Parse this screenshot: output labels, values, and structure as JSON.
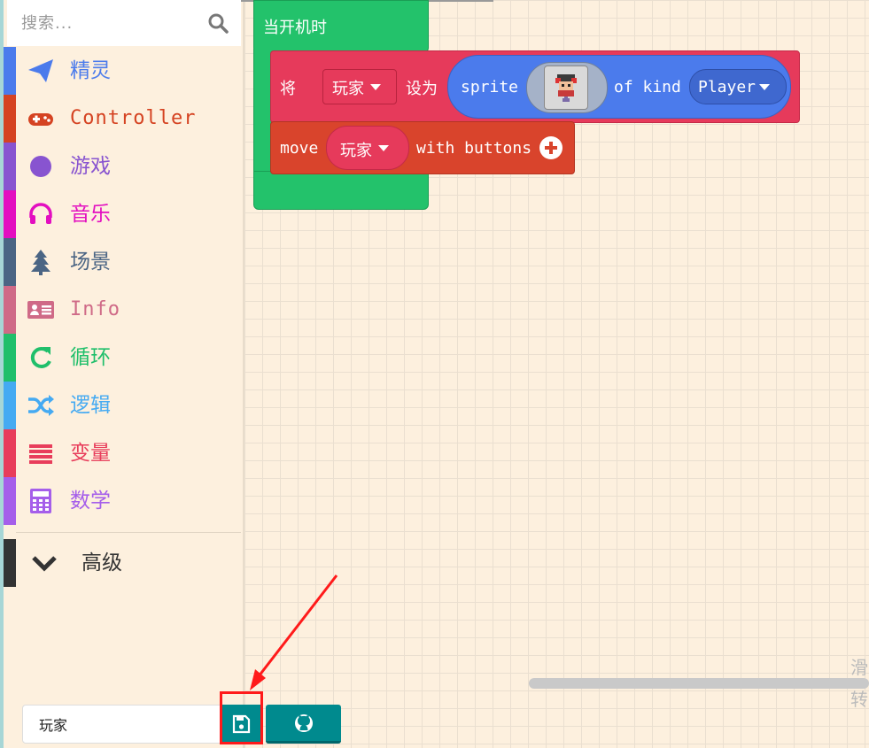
{
  "search": {
    "placeholder": "搜索..."
  },
  "categories": [
    {
      "label": "精灵",
      "color": "#4b7bec",
      "icon": "paper-plane-icon"
    },
    {
      "label": "Controller",
      "color": "#d54322",
      "icon": "gamepad-icon"
    },
    {
      "label": "游戏",
      "color": "#8854d0",
      "icon": "circle-icon"
    },
    {
      "label": "音乐",
      "color": "#e30fc0",
      "icon": "headphones-icon"
    },
    {
      "label": "场景",
      "color": "#4b6584",
      "icon": "tree-icon"
    },
    {
      "label": "Info",
      "color": "#cf6a87",
      "icon": "id-card-icon"
    },
    {
      "label": "循环",
      "color": "#20bf6b",
      "icon": "refresh-icon"
    },
    {
      "label": "逻辑",
      "color": "#45aaf2",
      "icon": "shuffle-icon"
    },
    {
      "label": "变量",
      "color": "#e83d5b",
      "icon": "list-icon"
    },
    {
      "label": "数学",
      "color": "#a55eea",
      "icon": "calculator-icon"
    },
    {
      "label": "高级",
      "color": "#333333",
      "icon": "chevron-down-icon"
    }
  ],
  "blocks": {
    "on_start": "当开机时",
    "set_label": "将",
    "set_variable": "玩家",
    "to_label": "设为",
    "sprite_label": "sprite",
    "of_kind_label": "of kind",
    "kind_value": "Player",
    "move_label": "move",
    "move_variable": "玩家",
    "with_buttons_label": "with buttons"
  },
  "edge_text": "滑 转",
  "footer": {
    "project_name": "玩家",
    "save_icon": "save-icon",
    "github_icon": "github-icon"
  }
}
